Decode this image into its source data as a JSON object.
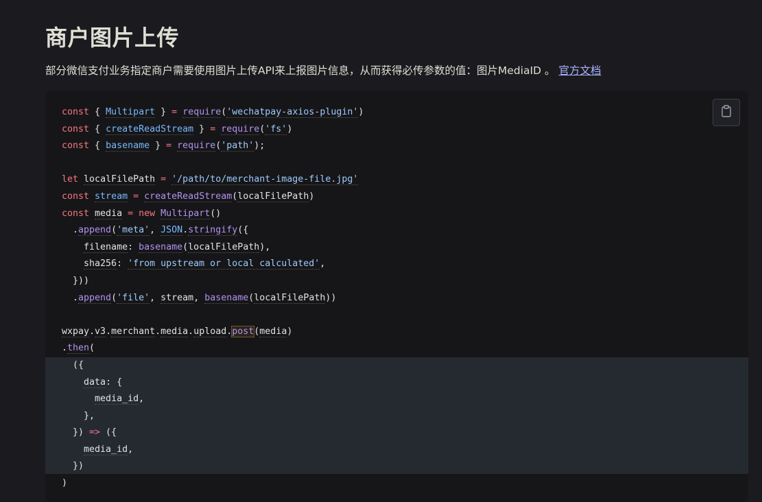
{
  "page": {
    "title": "商户图片上传",
    "description": "部分微信支付业务指定商户需要使用图片上传API来上报图片信息，从而获得必传参数的值：图片MediaID 。",
    "doc_link": "官方文档"
  },
  "code": {
    "copy_icon": "clipboard-icon",
    "lines": [
      "const { Multipart } = require('wechatpay-axios-plugin')",
      "const { createReadStream } = require('fs')",
      "const { basename } = require('path');",
      "",
      "let localFilePath = '/path/to/merchant-image-file.jpg'",
      "const stream = createReadStream(localFilePath)",
      "const media = new Multipart()",
      "  .append('meta', JSON.stringify({",
      "    filename: basename(localFilePath),",
      "    sha256: 'from upstream or local calculated',",
      "  }))",
      "  .append('file', stream, basename(localFilePath))",
      "",
      "wxpay.v3.merchant.media.upload.post(media)",
      ".then(",
      "  ({",
      "    data: {",
      "      media_id,",
      "    },",
      "  }) => ({",
      "    media_id,",
      "  })",
      ")"
    ]
  }
}
